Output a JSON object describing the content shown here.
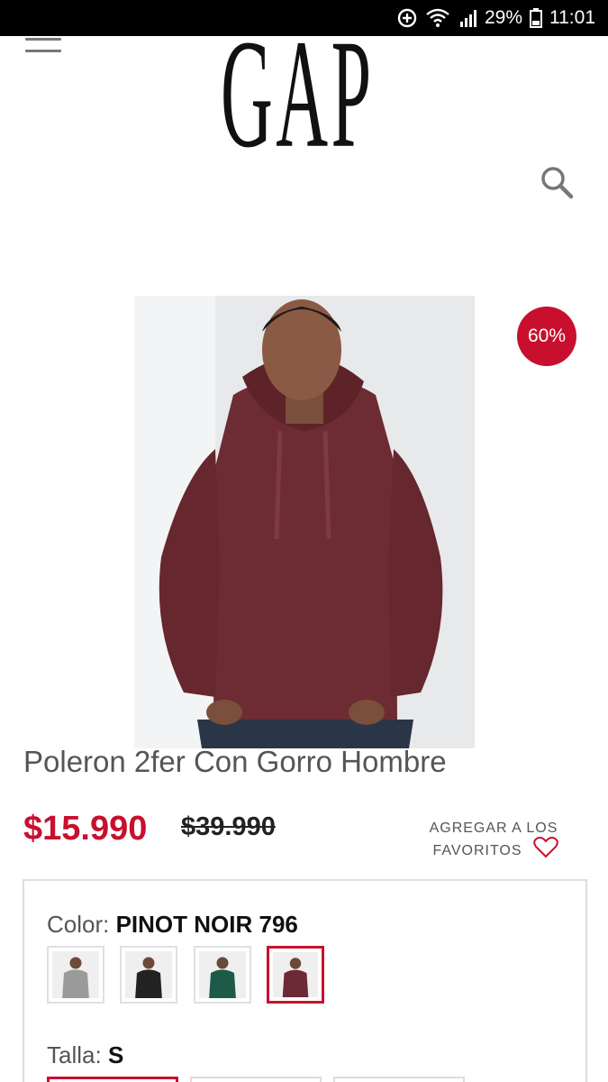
{
  "status_bar": {
    "battery": "29%",
    "time": "11:01"
  },
  "header": {
    "logo_text": "GAP"
  },
  "product": {
    "title": "Poleron 2fer Con Gorro Hombre",
    "discount_badge": "60%",
    "price_sale": "$15.990",
    "price_original": "$39.990",
    "favorites_line1": "AGREGAR A LOS",
    "favorites_line2": "FAVORITOS",
    "color_label": "Color:",
    "color_value": "PINOT NOIR 796",
    "color_swatches": [
      {
        "name": "grey",
        "color": "#9a9a9a"
      },
      {
        "name": "black",
        "color": "#222222"
      },
      {
        "name": "green",
        "color": "#1e5a48"
      },
      {
        "name": "pinot noir",
        "color": "#6b2a35",
        "selected": true
      }
    ],
    "size_label": "Talla:",
    "size_value": "S"
  },
  "colors": {
    "accent": "#c8102e",
    "product_bg": "#e9eaec",
    "hoodie": "#6d2b33"
  }
}
